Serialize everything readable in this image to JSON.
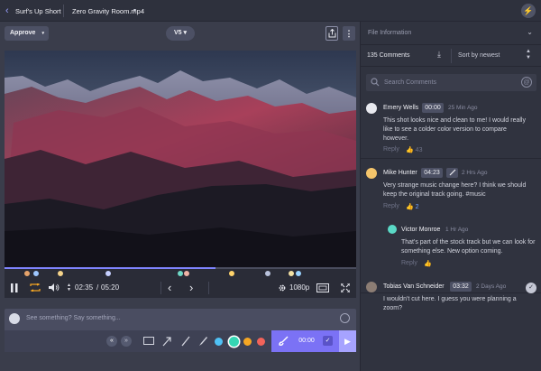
{
  "header": {
    "project": "Surf's Up Short",
    "file": "Zero Gravity Room.mp4",
    "file_caret": "▾",
    "back_glyph": "‹",
    "bolt_glyph": "⚡"
  },
  "toolbar": {
    "approve_label": "Approve",
    "approve_caret": "▾",
    "version_label": "V5 ▾",
    "more_glyph": "⋮"
  },
  "scrubber": {
    "progress": 0.6,
    "marker_colors": [
      "#e6a36b",
      "#9ec7ff",
      "#f5d38a",
      "#c6d0ff",
      "#6fd8c6",
      "#f0b3a6",
      "#ffd36b",
      "#b9c2dc",
      "#f3e1a3",
      "#9ad3ff"
    ]
  },
  "controls": {
    "time_current": "02:35",
    "time_separator": "/",
    "time_total": "05:20",
    "quality": "1080p",
    "prev_glyph": "‹",
    "next_glyph": "›"
  },
  "composer": {
    "placeholder": "See something? Say something...",
    "timecode": "00:00",
    "check_glyph": "✓",
    "send_glyph": "▶",
    "colors": [
      "#4fc1f5",
      "#34d6b4",
      "#f5a623",
      "#f2635a"
    ],
    "selected_color": 1
  },
  "panel": {
    "section_title": "File Information",
    "count_label": "135 Comments",
    "sort_label": "Sort by newest",
    "search_placeholder": "Search Comments",
    "at_glyph": "@",
    "comments": [
      {
        "name": "Emery Wells",
        "timecode": "00:00",
        "time": "25 Min Ago",
        "body": "This shot looks nice and clean to me! I would really like to see a colder color version to compare however.",
        "reply": "Reply",
        "likes": "43",
        "avatar_color": "#e8e9ef"
      },
      {
        "name": "Mike Hunter",
        "timecode": "04:23",
        "time": "2 Hrs Ago",
        "body": "Very strange music change here? I think we should keep the original track going. #music",
        "reply": "Reply",
        "likes": "2",
        "avatar_color": "#f5c56b"
      },
      {
        "name": "Victor Monroe",
        "time": "1 Hr Ago",
        "body": "That's part of the stock track but we can look for something else. New option coming.",
        "reply": "Reply",
        "likes": "",
        "avatar_color": "#5ad9c6"
      },
      {
        "name": "Tobias Van Schneider",
        "timecode": "03:32",
        "time": "2 Days Ago",
        "body": "I wouldn't cut here. I guess you were planning a zoom?",
        "avatar_color": "#8c7d74",
        "resolve_glyph": "✓"
      }
    ]
  }
}
